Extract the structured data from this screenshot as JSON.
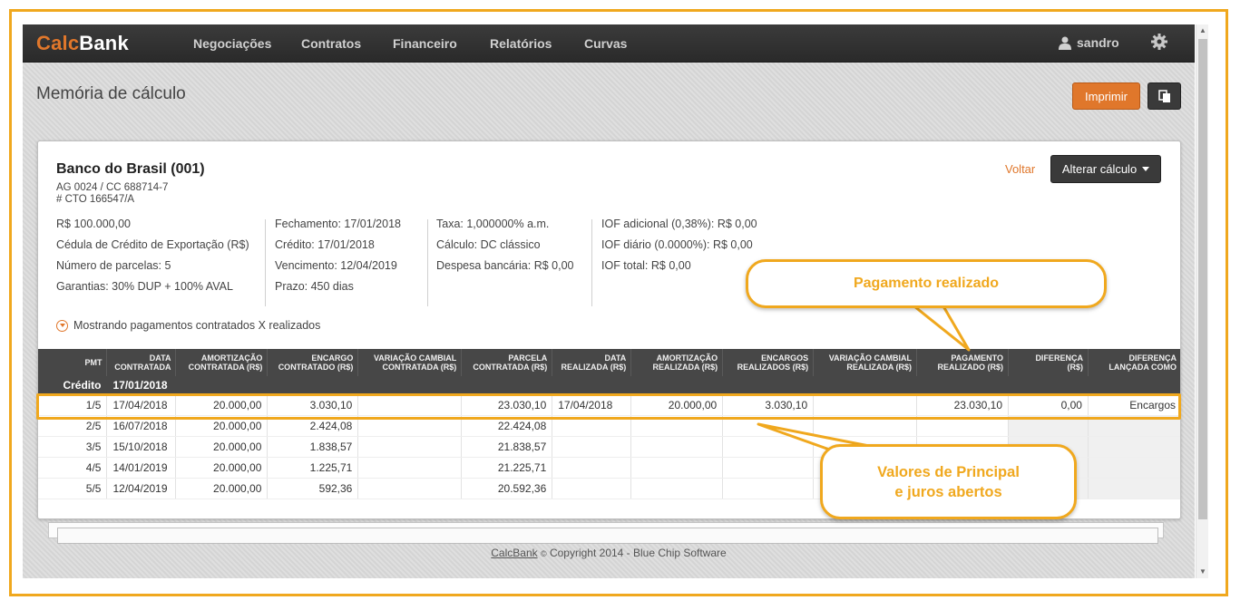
{
  "app": {
    "brand_part1": "Calc",
    "brand_part2": "Bank",
    "nav": [
      "Negociações",
      "Contratos",
      "Financeiro",
      "Relatórios",
      "Curvas"
    ],
    "user": "sandro",
    "icons": {
      "user": "user-icon",
      "settings": "gear-icon",
      "copy": "copy-icon",
      "caret": "caret-down-icon",
      "toggle": "chevron-circle-down-icon"
    },
    "accent_color": "#e0772b"
  },
  "page": {
    "title": "Memória de cálculo",
    "print_label": "Imprimir"
  },
  "contract": {
    "bank": "Banco do Brasil (001)",
    "account": "AG 0024 / CC 688714-7",
    "cto": "# CTO 166547/A",
    "back_label": "Voltar",
    "alter_label": "Alterar cálculo",
    "col1": [
      "R$ 100.000,00",
      "Cédula de Crédito de Exportação (R$)",
      "Número de parcelas: 5",
      "Garantias: 30% DUP + 100% AVAL"
    ],
    "col2": [
      "Fechamento: 17/01/2018",
      "Crédito: 17/01/2018",
      "Vencimento: 12/04/2019",
      "Prazo: 450 dias"
    ],
    "col3": [
      "Taxa: 1,000000% a.m.",
      "Cálculo: DC clássico",
      "Despesa bancária: R$ 0,00"
    ],
    "col4": [
      "IOF adicional (0,38%): R$ 0,00",
      "IOF diário (0.0000%): R$ 0,00",
      "IOF total: R$ 0,00"
    ],
    "toggle_label": "Mostrando pagamentos contratados X realizados"
  },
  "table": {
    "headers": [
      [
        "PMT",
        ""
      ],
      [
        "DATA",
        "CONTRATADA"
      ],
      [
        "AMORTIZAÇÃO",
        "CONTRATADA (R$)"
      ],
      [
        "ENCARGO",
        "CONTRATADO (R$)"
      ],
      [
        "VARIAÇÃO CAMBIAL",
        "CONTRATADA (R$)"
      ],
      [
        "PARCELA",
        "CONTRATADA (R$)"
      ],
      [
        "DATA",
        "REALIZADA (R$)"
      ],
      [
        "AMORTIZAÇÃO",
        "REALIZADA (R$)"
      ],
      [
        "ENCARGOS",
        "REALIZADOS (R$)"
      ],
      [
        "VARIAÇÃO CAMBIAL",
        "REALIZADA (R$)"
      ],
      [
        "PAGAMENTO",
        "REALIZADO (R$)"
      ],
      [
        "DIFERENÇA",
        "(R$)"
      ],
      [
        "DIFERENÇA",
        "LANÇADA COMO"
      ]
    ],
    "credit_row": {
      "label": "Crédito",
      "date": "17/01/2018"
    },
    "rows": [
      [
        "1/5",
        "17/04/2018",
        "20.000,00",
        "3.030,10",
        "",
        "23.030,10",
        "17/04/2018",
        "20.000,00",
        "3.030,10",
        "",
        "23.030,10",
        "0,00",
        "Encargos"
      ],
      [
        "2/5",
        "16/07/2018",
        "20.000,00",
        "2.424,08",
        "",
        "22.424,08",
        "",
        "",
        "",
        "",
        "",
        "",
        ""
      ],
      [
        "3/5",
        "15/10/2018",
        "20.000,00",
        "1.838,57",
        "",
        "21.838,57",
        "",
        "",
        "",
        "",
        "",
        "",
        ""
      ],
      [
        "4/5",
        "14/01/2019",
        "20.000,00",
        "1.225,71",
        "",
        "21.225,71",
        "",
        "",
        "",
        "",
        "",
        "",
        ""
      ],
      [
        "5/5",
        "12/04/2019",
        "20.000,00",
        "592,36",
        "",
        "20.592,36",
        "",
        "",
        "",
        "",
        "",
        "",
        ""
      ]
    ]
  },
  "callouts": {
    "payment": "Pagamento realizado",
    "open_line1": "Valores de Principal",
    "open_line2": "e juros abertos"
  },
  "footer": {
    "link": "CalcBank",
    "copyright_symbol": "©",
    "text": "Copyright 2014 - Blue Chip Software"
  }
}
